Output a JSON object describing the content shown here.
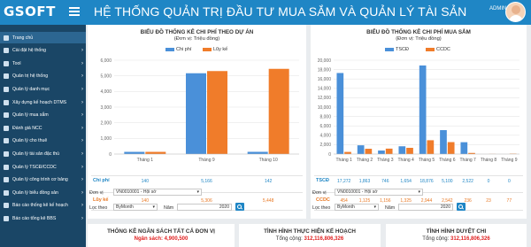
{
  "app": {
    "logo": "GSOFT",
    "title": "HỆ THỐNG QUẢN TRỊ ĐẦU TƯ MUA SẮM VÀ QUẢN LÝ TÀI SẢN",
    "user": "ADMIN"
  },
  "sidebar": {
    "items": [
      {
        "label": "Trang chủ",
        "icon": "home-icon",
        "has_children": false
      },
      {
        "label": "Cài đặt hệ thống",
        "icon": "settings-icon",
        "has_children": true
      },
      {
        "label": "Tool",
        "icon": "wrench-icon",
        "has_children": true
      },
      {
        "label": "Quản trị hệ thống",
        "icon": "admin-icon",
        "has_children": true
      },
      {
        "label": "Quản lý danh mục",
        "icon": "list-icon",
        "has_children": true
      },
      {
        "label": "Xây dựng kế hoạch DTMS",
        "icon": "plan-icon",
        "has_children": true
      },
      {
        "label": "Quản lý mua sắm",
        "icon": "cart-icon",
        "has_children": true
      },
      {
        "label": "Đánh giá NCC",
        "icon": "star-icon",
        "has_children": true
      },
      {
        "label": "Quản lý cho thuê",
        "icon": "rent-icon",
        "has_children": true
      },
      {
        "label": "Quản lý tài sản đặc thù",
        "icon": "car-icon",
        "has_children": true
      },
      {
        "label": "Quản lý TSCĐ/CCDC",
        "icon": "box-icon",
        "has_children": true
      },
      {
        "label": "Quản lý công trình cơ bảng",
        "icon": "building-icon",
        "has_children": true
      },
      {
        "label": "Quản lý biểu đồng sản",
        "icon": "chart-icon",
        "has_children": true
      },
      {
        "label": "Báo cáo thống kê kế hoạch",
        "icon": "report-icon",
        "has_children": true
      },
      {
        "label": "Báo cáo tổng kê BBS",
        "icon": "report2-icon",
        "has_children": true
      }
    ]
  },
  "colors": {
    "topbar": "#1f86c5",
    "sidebar": "#1a4666",
    "active": "#2c6691",
    "blue": "#4a90d9",
    "orange": "#f07c2a",
    "red": "#e02020"
  },
  "left_panel": {
    "title": "BIỂU ĐỒ THỐNG KÊ CHI PHÍ THEO DỰ ÁN",
    "unit": "(Đơn vị: Triệu đồng)",
    "row_labels": [
      "Chi phí",
      "Lũy kế"
    ],
    "rows": [
      [
        "140",
        "5,166",
        "142"
      ],
      [
        "140",
        "5,306",
        "5,448"
      ]
    ],
    "filters": {
      "unit_label": "Đơn vị",
      "unit_value": "VN0010001 - Hội sở",
      "filter_label": "Lọc theo",
      "filter_value": "ByMonth",
      "year_label": "Năm",
      "year_value": "2020"
    }
  },
  "right_panel": {
    "title": "BIỂU ĐỒ THỐNG KÊ CHI PHÍ MUA SẮM",
    "unit": "(Đơn vị: Triệu đồng)",
    "row_labels": [
      "TSCĐ",
      "CCDC"
    ],
    "rows": [
      [
        "17,272",
        "1,863",
        "746",
        "1,654",
        "18,876",
        "5,100",
        "2,522",
        "0",
        "0"
      ],
      [
        "454",
        "1,125",
        "1,156",
        "1,325",
        "2,944",
        "2,542",
        "236",
        "23",
        "77"
      ]
    ],
    "filters": {
      "unit_label": "Đơn vị",
      "unit_value": "VN0010001 - Hội sở",
      "filter_label": "Lọc theo",
      "filter_value": "ByMonth",
      "year_label": "Năm",
      "year_value": "2020"
    }
  },
  "bottom": [
    {
      "title": "THỐNG KÊ NGÂN SÁCH TẤT CẢ ĐƠN VỊ",
      "label": "Ngân sách:",
      "value": "4,900,500"
    },
    {
      "title": "TÌNH HÌNH THỰC HIỆN KẾ HOẠCH",
      "label": "Tổng cộng:",
      "value": "312,116,806,326"
    },
    {
      "title": "TÌNH HÌNH DUYỆT CHI",
      "label": "Tổng cộng:",
      "value": "312,116,806,326"
    }
  ],
  "chart_data": [
    {
      "type": "bar",
      "title": "BIỂU ĐỒ THỐNG KÊ CHI PHÍ THEO DỰ ÁN",
      "subtitle": "(Đơn vị: Triệu đồng)",
      "categories": [
        "Tháng 1",
        "Tháng 9",
        "Tháng 10"
      ],
      "series": [
        {
          "name": "Chi phí",
          "values": [
            140,
            5166,
            142
          ],
          "color": "#4a90d9"
        },
        {
          "name": "Lũy kế",
          "values": [
            140,
            5306,
            5448
          ],
          "color": "#f07c2a"
        }
      ],
      "ylim": [
        0,
        6000
      ],
      "yticks": [
        "0",
        "1,000",
        "2,000",
        "3,000",
        "4,000",
        "5,000",
        "6,000"
      ],
      "grid": true,
      "legend": "top-center"
    },
    {
      "type": "bar",
      "title": "BIỂU ĐỒ THỐNG KÊ CHI PHÍ MUA SẮM",
      "subtitle": "(Đơn vị: Triệu đồng)",
      "categories": [
        "Tháng 1",
        "Tháng 2",
        "Tháng 3",
        "Tháng 4",
        "Tháng 5",
        "Tháng 6",
        "Tháng 7",
        "Tháng 8",
        "Tháng 9"
      ],
      "series": [
        {
          "name": "TSCĐ",
          "values": [
            17272,
            1863,
            746,
            1654,
            18876,
            5100,
            2522,
            0,
            0
          ],
          "color": "#4a90d9"
        },
        {
          "name": "CCDC",
          "values": [
            454,
            1125,
            1156,
            1325,
            2944,
            2542,
            236,
            23,
            77
          ],
          "color": "#f07c2a"
        }
      ],
      "ylim": [
        0,
        20000
      ],
      "yticks": [
        "0",
        "2,000",
        "4,000",
        "6,000",
        "8,000",
        "10,000",
        "12,000",
        "14,000",
        "16,000",
        "18,000",
        "20,000"
      ],
      "grid": true,
      "legend": "top-center"
    }
  ]
}
